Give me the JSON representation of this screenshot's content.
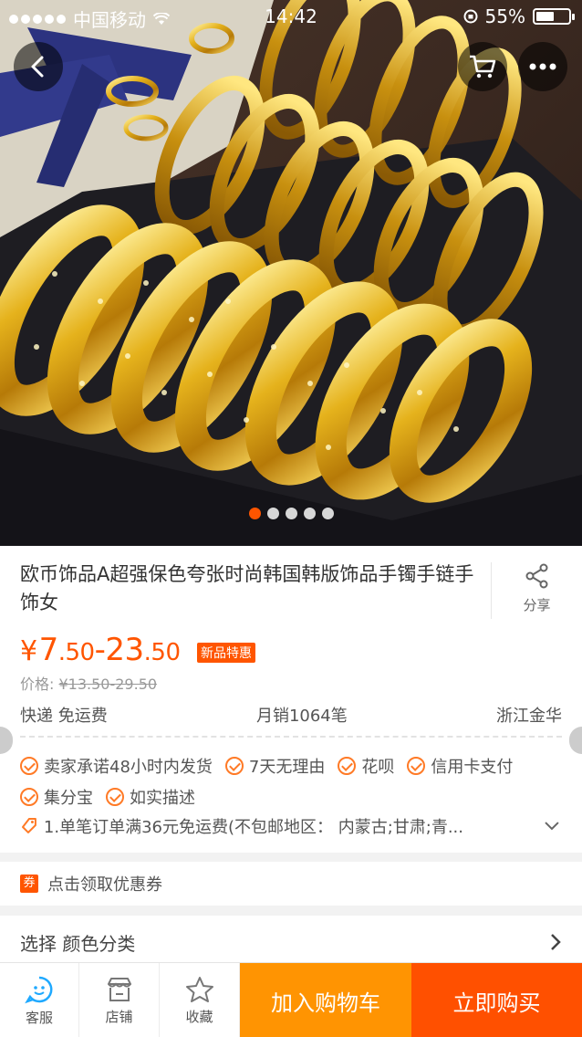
{
  "status_bar": {
    "carrier": "中国移动",
    "time": "14:42",
    "battery": "55%",
    "battery_level": 0.55
  },
  "nav": {
    "back_icon": "chevron-left-icon",
    "cart_icon": "cart-icon",
    "more_icon": "more-icon"
  },
  "gallery": {
    "total": 5,
    "active_index": 0
  },
  "product": {
    "title": "欧币饰品A超强保色夸张时尚韩国韩版饰品手镯手链手饰女",
    "share_label": "分享",
    "price_symbol": "¥",
    "price_low_int": "7",
    "price_low_dec": ".50",
    "price_sep": "-",
    "price_high_int": "23",
    "price_high_dec": ".50",
    "badge": "新品特惠",
    "old_price_label": "价格: ",
    "old_price_value": "¥13.50-29.50",
    "shipping": "快递 免运费",
    "monthly_sales": "月销1064笔",
    "location": "浙江金华"
  },
  "services": {
    "line1": [
      "卖家承诺48小时内发货",
      "7天无理由",
      "花呗",
      "信用卡支付"
    ],
    "line2": [
      "集分宝",
      "如实描述"
    ],
    "promo": "1.单笔订单满36元免运费(不包邮地区： 内蒙古;甘肃;青..."
  },
  "coupon": {
    "tag": "券",
    "label": "点击领取优惠券"
  },
  "select": {
    "label": "选择 颜色分类"
  },
  "tabbar": {
    "service": "客服",
    "shop": "店铺",
    "favorite": "收藏",
    "add_to_cart": "加入购物车",
    "buy_now": "立即购买"
  },
  "colors": {
    "accent": "#ff5500",
    "cart_button": "#ff9402",
    "buy_button": "#ff5000",
    "service_icon": "#1fa9ff"
  }
}
